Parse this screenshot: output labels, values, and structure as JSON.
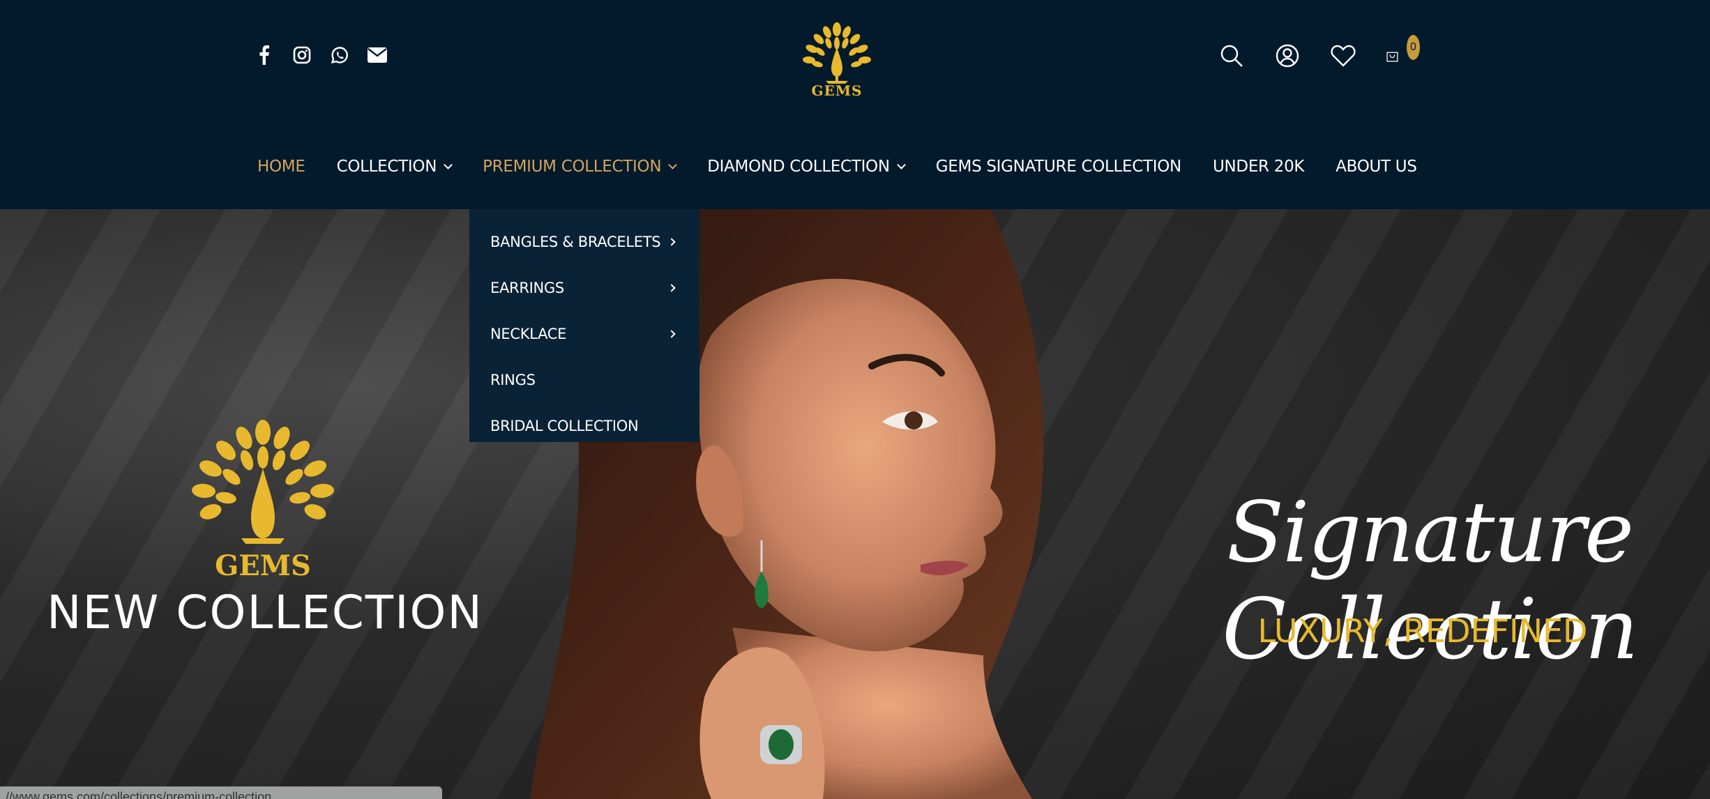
{
  "header": {
    "logo_text": "GEMS",
    "cart_count": "0",
    "social": [
      "facebook-icon",
      "instagram-icon",
      "whatsapp-icon",
      "email-icon"
    ],
    "icons": [
      "search-icon",
      "account-icon",
      "wishlist-icon",
      "cart-icon"
    ]
  },
  "nav": {
    "items": [
      {
        "label": "HOME",
        "active": true
      },
      {
        "label": "COLLECTION",
        "has_dropdown": true
      },
      {
        "label": "PREMIUM COLLECTION",
        "has_dropdown": true,
        "open": true
      },
      {
        "label": "DIAMOND COLLECTION",
        "has_dropdown": true
      },
      {
        "label": "GEMS SIGNATURE COLLECTION"
      },
      {
        "label": "UNDER 20K"
      },
      {
        "label": "ABOUT US"
      }
    ]
  },
  "dropdown": {
    "items": [
      {
        "label": "BANGLES & BRACELETS",
        "has_submenu": true
      },
      {
        "label": "EARRINGS",
        "has_submenu": true
      },
      {
        "label": "NECKLACE",
        "has_submenu": true
      },
      {
        "label": "RINGS",
        "has_submenu": false
      },
      {
        "label": "BRIDAL COLLECTION",
        "has_submenu": false
      }
    ]
  },
  "hero": {
    "brand": "GEMS",
    "left_heading": "NEW  COLLECTION",
    "signature_title": "Signature Collection",
    "signature_subtitle": "LUXURY, REDEFINED"
  },
  "status_bar": {
    "url": "//www.gems.com/collections/premium-collection"
  },
  "colors": {
    "header_bg": "#021a2c",
    "accent_gold": "#d6a35a",
    "logo_yellow": "#e8b92e",
    "dropdown_bg": "#0a2236"
  }
}
